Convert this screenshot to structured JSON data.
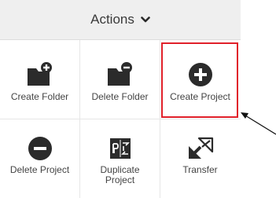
{
  "header": {
    "title": "Actions",
    "chevron_icon": "chevron-down-icon"
  },
  "tiles": [
    {
      "label": "Create Folder",
      "icon": "folder-add-icon"
    },
    {
      "label": "Delete Folder",
      "icon": "folder-remove-icon"
    },
    {
      "label": "Create Project",
      "icon": "plus-circle-icon"
    },
    {
      "label": "Delete Project",
      "icon": "minus-circle-icon"
    },
    {
      "label_line1": "Duplicate",
      "label_line2": "Project",
      "icon": "duplicate-project-icon"
    },
    {
      "label": "Transfer",
      "icon": "transfer-icon"
    }
  ],
  "colors": {
    "icon": "#2b2b2b",
    "highlight": "#e0202a",
    "header_bg": "#efefef"
  }
}
